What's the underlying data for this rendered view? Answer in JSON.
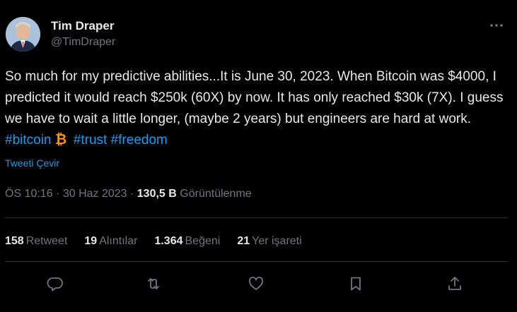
{
  "author": {
    "name": "Tim Draper",
    "handle": "@TimDraper"
  },
  "tweet": {
    "text_plain": "So much for my predictive abilities...It is June 30, 2023. When Bitcoin was $4000, I predicted it would reach $250k (60X) by now. It has only reached $30k (7X). I guess we have to wait a little longer, (maybe 2 years) but engineers are hard at work.",
    "hashtags": [
      "#bitcoin",
      "#trust",
      "#freedom"
    ],
    "translate_label": "Tweeti Çevir"
  },
  "meta": {
    "time": "ÖS 10:16",
    "separator": " · ",
    "date": "30 Haz 2023",
    "views_count": "130,5 B",
    "views_label": "Görüntülenme"
  },
  "stats": [
    {
      "count": "158",
      "label": "Retweet"
    },
    {
      "count": "19",
      "label": "Alıntılar"
    },
    {
      "count": "1.364",
      "label": "Beğeni"
    },
    {
      "count": "21",
      "label": "Yer işareti"
    }
  ],
  "colors": {
    "background": "#000000",
    "text": "#e7e9ea",
    "muted": "#71767b",
    "accent": "#1d9bf0",
    "divider": "#2f3336",
    "bitcoin": "#f7931a"
  },
  "icons": {
    "more": "more-horizontal-icon",
    "reply": "reply-icon",
    "retweet": "retweet-icon",
    "like": "heart-icon",
    "bookmark": "bookmark-icon",
    "share": "share-icon",
    "bitcoin_emoji": "bitcoin-icon"
  }
}
